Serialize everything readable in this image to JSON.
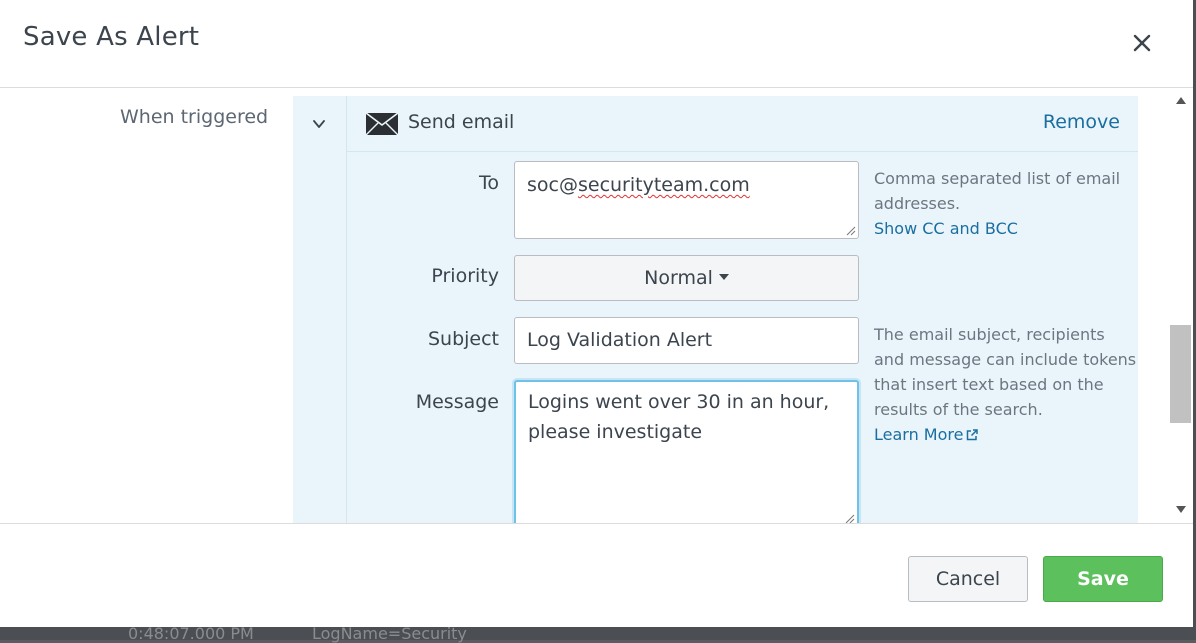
{
  "background": {
    "row_text_1": "0:48:07.000 PM",
    "row_text_2": "LogName=Security"
  },
  "dialog": {
    "title": "Save As Alert",
    "close_icon": "close-icon"
  },
  "trigger_section": {
    "label": "When triggered",
    "action": {
      "icon": "envelope-icon",
      "title": "Send email",
      "remove_label": "Remove",
      "fields": {
        "to": {
          "label": "To",
          "value_prefix": "soc@",
          "value_misspelled": "securityteam.com",
          "help": "Comma separated list of email addresses.",
          "help_link": "Show CC and BCC"
        },
        "priority": {
          "label": "Priority",
          "value": "Normal"
        },
        "subject": {
          "label": "Subject",
          "value": "Log Validation Alert",
          "help": "The email subject, recipients and message can include tokens that insert text based on the results of the search.",
          "help_link": "Learn More"
        },
        "message": {
          "label": "Message",
          "value": "Logins went over 30 in an hour, please investigate"
        }
      }
    }
  },
  "footer": {
    "cancel_label": "Cancel",
    "save_label": "Save"
  },
  "colors": {
    "accent_link": "#1a6ea0",
    "save_green": "#5cc05c",
    "panel_bg": "#eaf5fb",
    "focus_border": "#6fc1e8"
  }
}
